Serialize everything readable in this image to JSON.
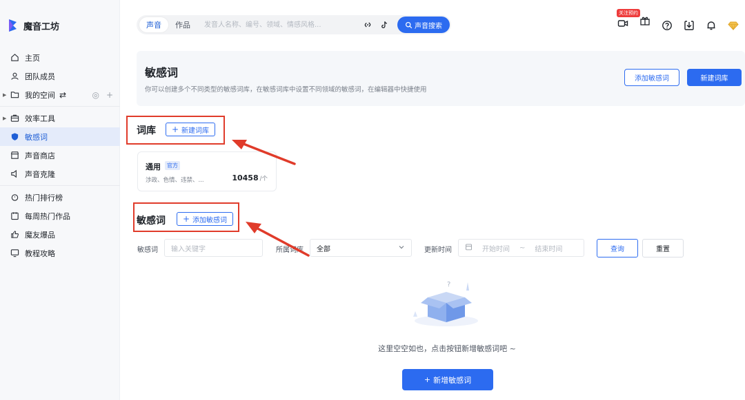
{
  "brand": {
    "name": "魔音工坊"
  },
  "sidebar": {
    "items": [
      {
        "label": "主页",
        "icon": "home-icon"
      },
      {
        "label": "团队成员",
        "icon": "user-icon"
      },
      {
        "label": "我的空间",
        "icon": "folder-icon"
      },
      {
        "label": "效率工具",
        "icon": "toolbox-icon"
      },
      {
        "label": "敏感词",
        "icon": "shield-icon",
        "active": true
      },
      {
        "label": "声音商店",
        "icon": "store-icon"
      },
      {
        "label": "声音克隆",
        "icon": "speaker-icon"
      },
      {
        "label": "热门排行榜",
        "icon": "medal-icon"
      },
      {
        "label": "每周热门作品",
        "icon": "calendar-icon"
      },
      {
        "label": "魔友爆品",
        "icon": "thumbs-up-icon"
      },
      {
        "label": "教程攻略",
        "icon": "monitor-icon"
      }
    ]
  },
  "topbar": {
    "tabs": [
      "声音",
      "作品"
    ],
    "search_placeholder": "发音人名称、编号、领域、情感风格...",
    "search_button": "声音搜索",
    "badge": "关注预约"
  },
  "header": {
    "title": "敏感词",
    "description": "你可以创建多个不同类型的敏感词库，在敏感词库中设置不同领域的敏感词，在编辑器中快捷使用",
    "add_button": "添加敏感词",
    "new_lib_button": "新建词库"
  },
  "library": {
    "title": "词库",
    "new_button": "新建词库",
    "card": {
      "name": "通用",
      "tag": "官方",
      "categories": "涉政、色情、违禁、...",
      "count": "10458",
      "unit": "/个"
    }
  },
  "words": {
    "title": "敏感词",
    "add_button": "添加敏感词",
    "filters": {
      "keyword_label": "敏感词",
      "keyword_placeholder": "输入关键字",
      "lib_label": "所属词库",
      "lib_value": "全部",
      "time_label": "更新时间",
      "start_placeholder": "开始时间",
      "end_placeholder": "结束时间",
      "range_sep": "~",
      "query_button": "查询",
      "reset_button": "重置"
    },
    "empty_text": "这里空空如也，点击按钮新增敏感词吧 ~",
    "empty_button": "新增敏感词"
  },
  "colors": {
    "accent": "#2c6bf0",
    "annotation": "#e03b2a",
    "active_bg": "#e4ebfa"
  }
}
